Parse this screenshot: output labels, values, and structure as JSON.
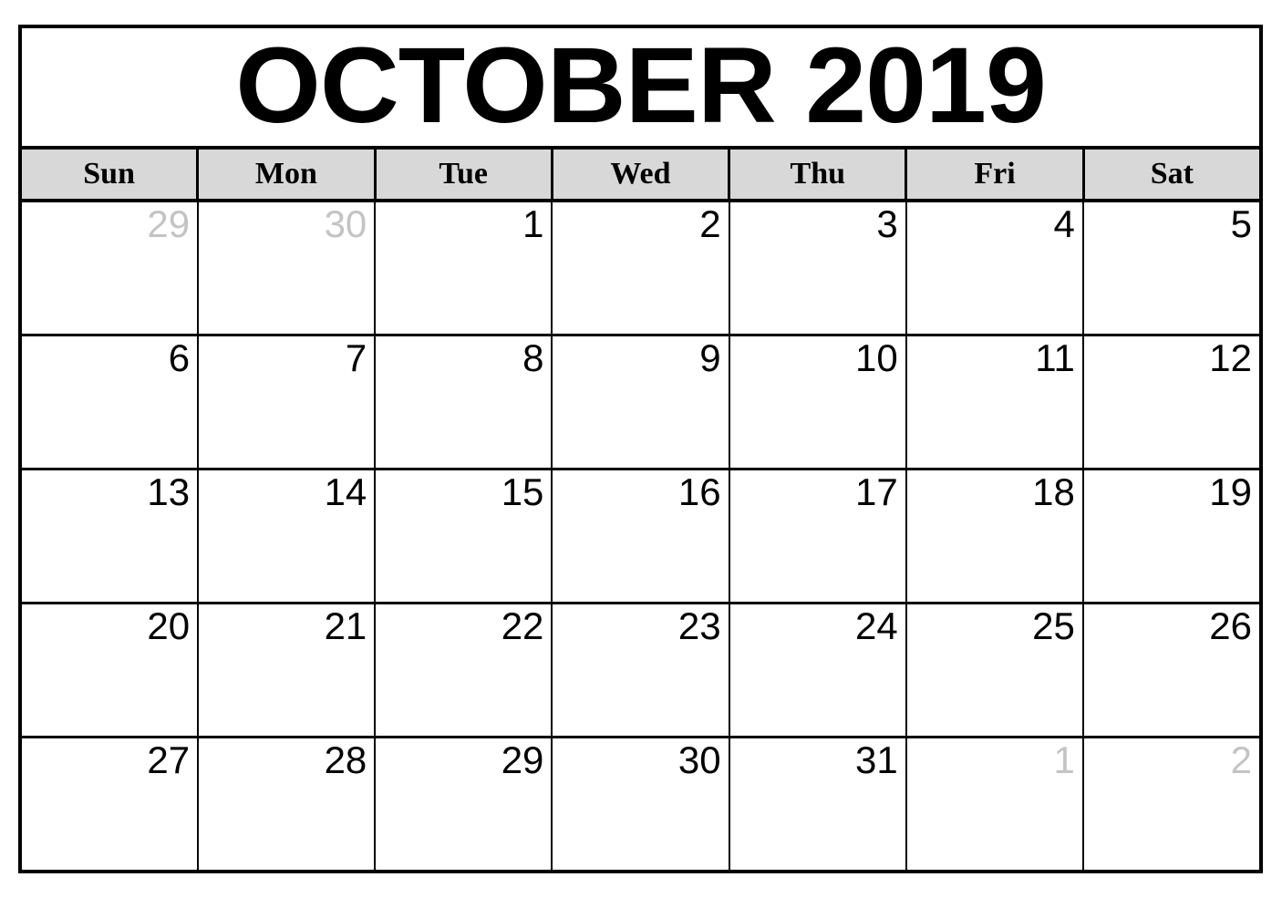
{
  "calendar": {
    "title": "OCTOBER 2019",
    "month": "October",
    "year": "2019",
    "colors": {
      "frame_border": "#000000",
      "header_background": "#d8d8d8",
      "in_month_number": "#000000",
      "out_of_month_number": "#c4c4c4",
      "cell_background": "#ffffff"
    },
    "weekdays": [
      {
        "label": "Sun"
      },
      {
        "label": "Mon"
      },
      {
        "label": "Tue"
      },
      {
        "label": "Wed"
      },
      {
        "label": "Thu"
      },
      {
        "label": "Fri"
      },
      {
        "label": "Sat"
      }
    ],
    "weeks": [
      [
        {
          "number": "29",
          "in_month": false
        },
        {
          "number": "30",
          "in_month": false
        },
        {
          "number": "1",
          "in_month": true
        },
        {
          "number": "2",
          "in_month": true
        },
        {
          "number": "3",
          "in_month": true
        },
        {
          "number": "4",
          "in_month": true
        },
        {
          "number": "5",
          "in_month": true
        }
      ],
      [
        {
          "number": "6",
          "in_month": true
        },
        {
          "number": "7",
          "in_month": true
        },
        {
          "number": "8",
          "in_month": true
        },
        {
          "number": "9",
          "in_month": true
        },
        {
          "number": "10",
          "in_month": true
        },
        {
          "number": "11",
          "in_month": true
        },
        {
          "number": "12",
          "in_month": true
        }
      ],
      [
        {
          "number": "13",
          "in_month": true
        },
        {
          "number": "14",
          "in_month": true
        },
        {
          "number": "15",
          "in_month": true
        },
        {
          "number": "16",
          "in_month": true
        },
        {
          "number": "17",
          "in_month": true
        },
        {
          "number": "18",
          "in_month": true
        },
        {
          "number": "19",
          "in_month": true
        }
      ],
      [
        {
          "number": "20",
          "in_month": true
        },
        {
          "number": "21",
          "in_month": true
        },
        {
          "number": "22",
          "in_month": true
        },
        {
          "number": "23",
          "in_month": true
        },
        {
          "number": "24",
          "in_month": true
        },
        {
          "number": "25",
          "in_month": true
        },
        {
          "number": "26",
          "in_month": true
        }
      ],
      [
        {
          "number": "27",
          "in_month": true
        },
        {
          "number": "28",
          "in_month": true
        },
        {
          "number": "29",
          "in_month": true
        },
        {
          "number": "30",
          "in_month": true
        },
        {
          "number": "31",
          "in_month": true
        },
        {
          "number": "1",
          "in_month": false
        },
        {
          "number": "2",
          "in_month": false
        }
      ]
    ]
  }
}
